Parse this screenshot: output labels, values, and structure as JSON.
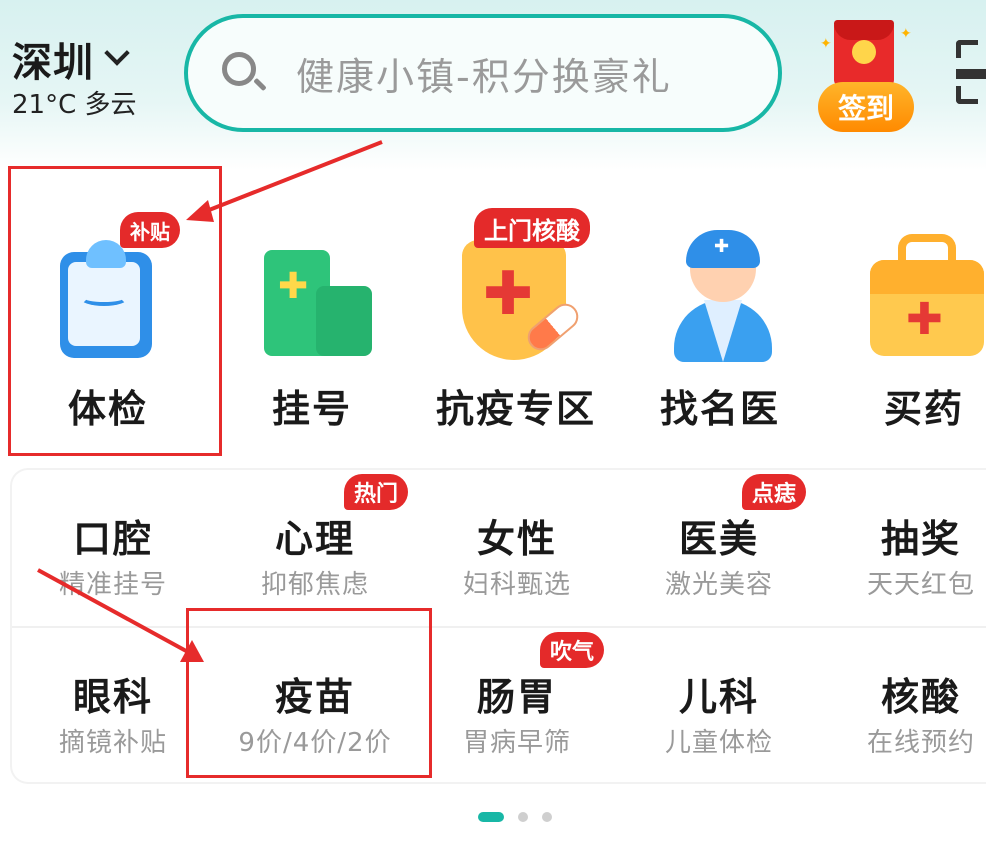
{
  "header": {
    "city": "深圳",
    "weather": "21°C 多云",
    "search_placeholder": "健康小镇-积分换豪礼",
    "checkin_label": "签到"
  },
  "main_services": [
    {
      "label": "体检",
      "badge": "补贴"
    },
    {
      "label": "挂号",
      "badge": ""
    },
    {
      "label": "抗疫专区",
      "badge": "上门核酸"
    },
    {
      "label": "找名医",
      "badge": ""
    },
    {
      "label": "买药",
      "badge": ""
    }
  ],
  "grid_rows": [
    [
      {
        "title": "口腔",
        "subtitle": "精准挂号",
        "badge": ""
      },
      {
        "title": "心理",
        "subtitle": "抑郁焦虑",
        "badge": "热门"
      },
      {
        "title": "女性",
        "subtitle": "妇科甄选",
        "badge": ""
      },
      {
        "title": "医美",
        "subtitle": "激光美容",
        "badge": "点痣"
      },
      {
        "title": "抽奖",
        "subtitle": "天天红包",
        "badge": ""
      }
    ],
    [
      {
        "title": "眼科",
        "subtitle": "摘镜补贴",
        "badge": ""
      },
      {
        "title": "疫苗",
        "subtitle": "9价/4价/2价",
        "badge": ""
      },
      {
        "title": "肠胃",
        "subtitle": "胃病早筛",
        "badge": "吹气"
      },
      {
        "title": "儿科",
        "subtitle": "儿童体检",
        "badge": ""
      },
      {
        "title": "核酸",
        "subtitle": "在线预约",
        "badge": ""
      }
    ]
  ],
  "pager": {
    "pages": 3,
    "active": 0
  },
  "colors": {
    "accent": "#18b7a6",
    "badge": "#e42a2a",
    "highlight": "#e62b2b"
  }
}
